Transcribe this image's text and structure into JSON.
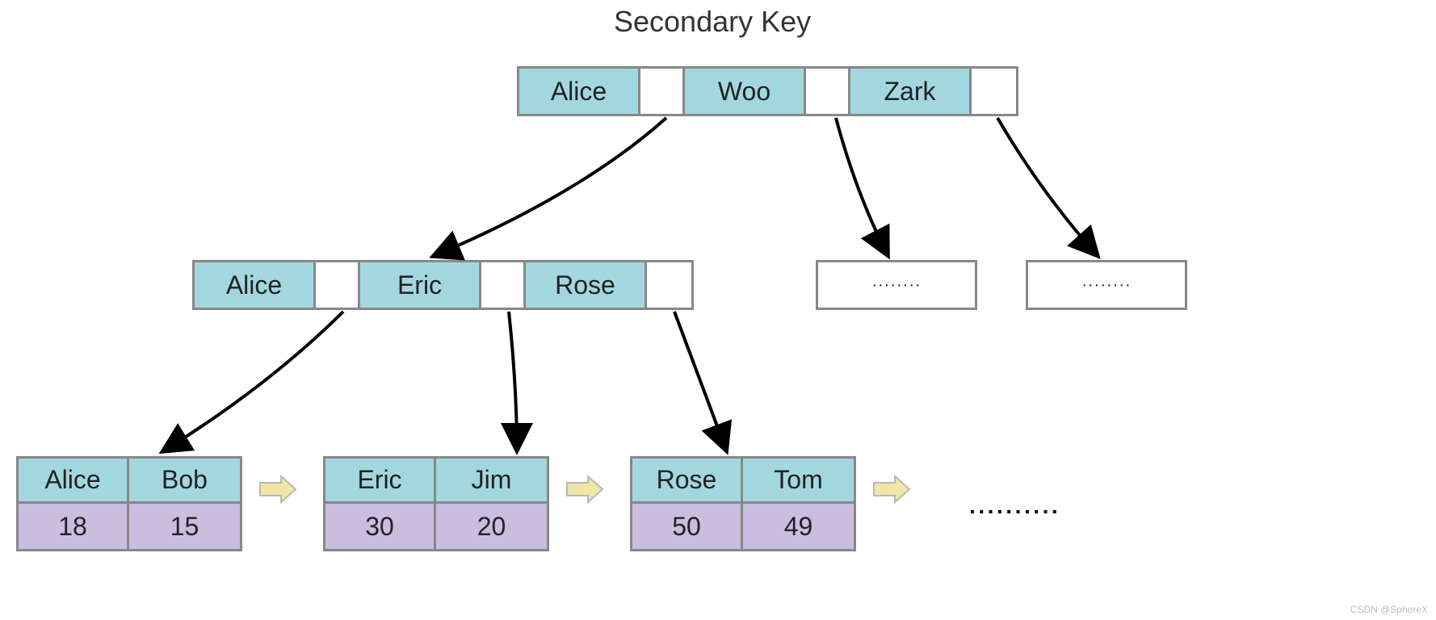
{
  "title": "Secondary  Key",
  "root": {
    "keys": [
      "Alice",
      "Woo",
      "Zark"
    ]
  },
  "mid": {
    "keys": [
      "Alice",
      "Eric",
      "Rose"
    ]
  },
  "placeholders": {
    "text": "········"
  },
  "leaves": [
    {
      "keys": [
        "Alice",
        "Bob"
      ],
      "vals": [
        "18",
        "15"
      ]
    },
    {
      "keys": [
        "Eric",
        "Jim"
      ],
      "vals": [
        "30",
        "20"
      ]
    },
    {
      "keys": [
        "Rose",
        "Tom"
      ],
      "vals": [
        "50",
        "49"
      ]
    }
  ],
  "trailing_dots": "··········",
  "watermark": "CSDN @SphereX",
  "colors": {
    "key_bg": "#a3d7e0",
    "val_bg": "#c9bde0",
    "border": "#888888"
  }
}
